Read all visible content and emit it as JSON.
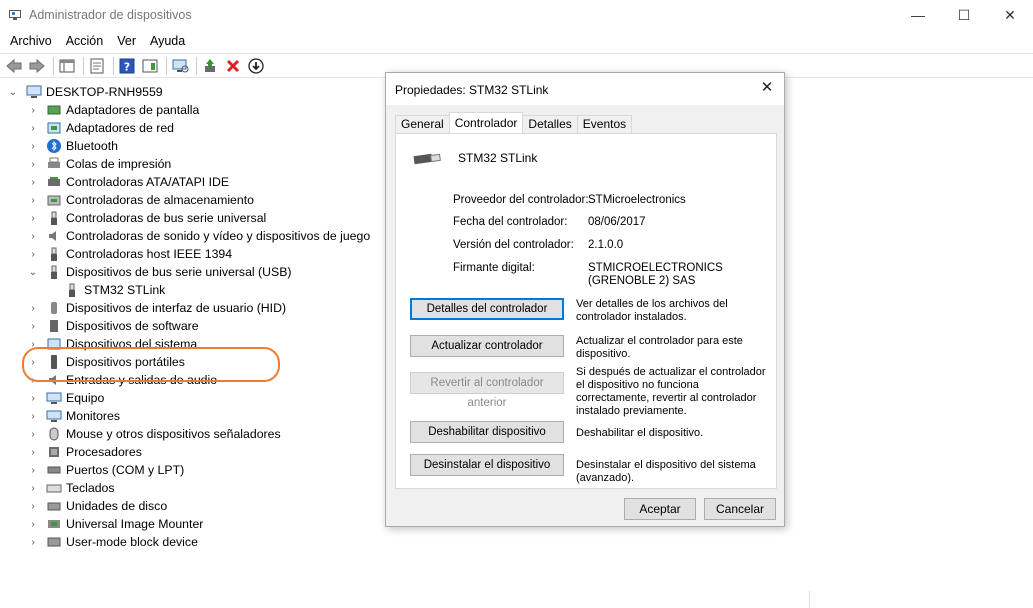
{
  "window": {
    "title": "Administrador de dispositivos",
    "minimize": "—",
    "maximize": "☐",
    "close": "✕"
  },
  "menu": [
    "Archivo",
    "Acción",
    "Ver",
    "Ayuda"
  ],
  "tree": {
    "root": "DESKTOP-RNH9559",
    "categories": [
      {
        "label": "Adaptadores de pantalla",
        "icon": "display-adapter-icon"
      },
      {
        "label": "Adaptadores de red",
        "icon": "network-adapter-icon"
      },
      {
        "label": "Bluetooth",
        "icon": "bluetooth-icon"
      },
      {
        "label": "Colas de impresión",
        "icon": "printer-icon"
      },
      {
        "label": "Controladoras ATA/ATAPI IDE",
        "icon": "ide-controller-icon"
      },
      {
        "label": "Controladoras de almacenamiento",
        "icon": "storage-controller-icon"
      },
      {
        "label": "Controladoras de bus serie universal",
        "icon": "usb-plug-icon"
      },
      {
        "label": "Controladoras de sonido y vídeo y dispositivos de juego",
        "icon": "speaker-icon"
      },
      {
        "label": "Controladoras host IEEE 1394",
        "icon": "firewire-icon"
      },
      {
        "label": "Dispositivos de bus serie universal (USB)",
        "icon": "usb-plug-icon",
        "expanded": true
      },
      {
        "label": "Dispositivos de interfaz de usuario (HID)",
        "icon": "hid-icon"
      },
      {
        "label": "Dispositivos de software",
        "icon": "software-device-icon"
      },
      {
        "label": "Dispositivos del sistema",
        "icon": "system-device-icon"
      },
      {
        "label": "Dispositivos portátiles",
        "icon": "portable-device-icon"
      },
      {
        "label": "Entradas y salidas de audio",
        "icon": "audio-io-icon"
      },
      {
        "label": "Equipo",
        "icon": "computer-icon"
      },
      {
        "label": "Monitores",
        "icon": "monitor-icon"
      },
      {
        "label": "Mouse y otros dispositivos señaladores",
        "icon": "mouse-icon"
      },
      {
        "label": "Procesadores",
        "icon": "processor-icon"
      },
      {
        "label": "Puertos (COM y LPT)",
        "icon": "port-icon"
      },
      {
        "label": "Teclados",
        "icon": "keyboard-icon"
      },
      {
        "label": "Unidades de disco",
        "icon": "disk-drive-icon"
      },
      {
        "label": "Universal Image Mounter",
        "icon": "image-mounter-icon"
      },
      {
        "label": "User-mode block device",
        "icon": "block-device-icon"
      }
    ],
    "expanded_child": "STM32 STLink"
  },
  "dialog": {
    "title": "Propiedades: STM32 STLink",
    "tabs": [
      "General",
      "Controlador",
      "Detalles",
      "Eventos"
    ],
    "active_tab": "Controlador",
    "device_name": "STM32 STLink",
    "props": {
      "provider_label": "Proveedor del controlador:",
      "provider_value": "STMicroelectronics",
      "date_label": "Fecha del controlador:",
      "date_value": "08/06/2017",
      "version_label": "Versión del controlador:",
      "version_value": "2.1.0.0",
      "signer_label": "Firmante digital:",
      "signer_value_1": "STMICROELECTRONICS",
      "signer_value_2": "(GRENOBLE 2) SAS"
    },
    "actions": {
      "details_btn": "Detalles del controlador",
      "details_desc": "Ver detalles de los archivos del controlador instalados.",
      "update_btn": "Actualizar controlador",
      "update_desc": "Actualizar el controlador para este dispositivo.",
      "rollback_btn": "Revertir al controlador anterior",
      "rollback_desc": "Si después de actualizar el controlador el dispositivo no funciona correctamente, revertir al controlador instalado previamente.",
      "disable_btn": "Deshabilitar dispositivo",
      "disable_desc": "Deshabilitar el dispositivo.",
      "uninstall_btn": "Desinstalar el dispositivo",
      "uninstall_desc": "Desinstalar el dispositivo del sistema (avanzado)."
    },
    "ok": "Aceptar",
    "cancel": "Cancelar",
    "close": "✕"
  },
  "colors": {
    "highlight_ring": "#ed7d31",
    "default_button_border": "#0078d7"
  }
}
